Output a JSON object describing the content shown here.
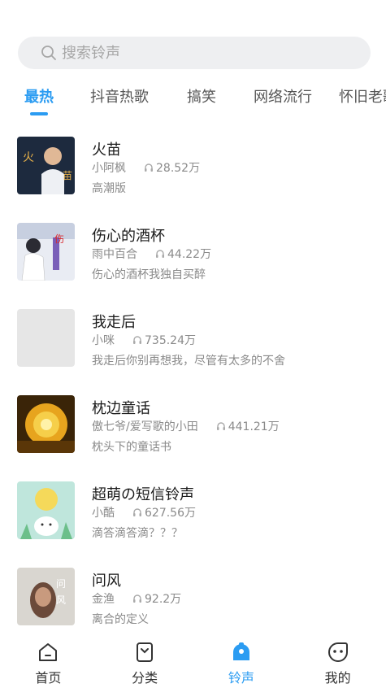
{
  "search": {
    "placeholder": "搜索铃声"
  },
  "tabs": [
    {
      "label": "最热",
      "active": true
    },
    {
      "label": "抖音热歌",
      "active": false
    },
    {
      "label": "搞笑",
      "active": false
    },
    {
      "label": "网络流行",
      "active": false
    },
    {
      "label": "怀旧老歌",
      "active": false
    }
  ],
  "songs": [
    {
      "title": "火苗",
      "artist": "小阿枫",
      "plays": "28.52万",
      "desc": "高潮版",
      "cover_text": "火 苗"
    },
    {
      "title": "伤心的酒杯",
      "artist": "雨中百合",
      "plays": "44.22万",
      "desc": "伤心的酒杯我独自买醉",
      "cover_text": "伤"
    },
    {
      "title": "我走后",
      "artist": "小咪",
      "plays": "735.24万",
      "desc": "我走后你别再想我，尽管有太多的不舍",
      "cover_text": ""
    },
    {
      "title": "枕边童话",
      "artist": "傲七爷/爱写歌的小田",
      "plays": "441.21万",
      "desc": "枕头下的童话书",
      "cover_text": ""
    },
    {
      "title": "超萌の短信铃声",
      "artist": "小酷",
      "plays": "627.56万",
      "desc": "滴答滴答滴？？？",
      "cover_text": ""
    },
    {
      "title": "问风",
      "artist": "金渔",
      "plays": "92.2万",
      "desc": "离合的定义",
      "cover_text": "问 风"
    }
  ],
  "nav": [
    {
      "label": "首页",
      "icon": "home-icon",
      "active": false
    },
    {
      "label": "分类",
      "icon": "bookmark-icon",
      "active": false
    },
    {
      "label": "铃声",
      "icon": "bell-icon",
      "active": true
    },
    {
      "label": "我的",
      "icon": "profile-icon",
      "active": false
    }
  ],
  "colors": {
    "accent": "#2b9cf2",
    "search_bg": "#eeeff1",
    "text_secondary": "#8a8a8a"
  }
}
